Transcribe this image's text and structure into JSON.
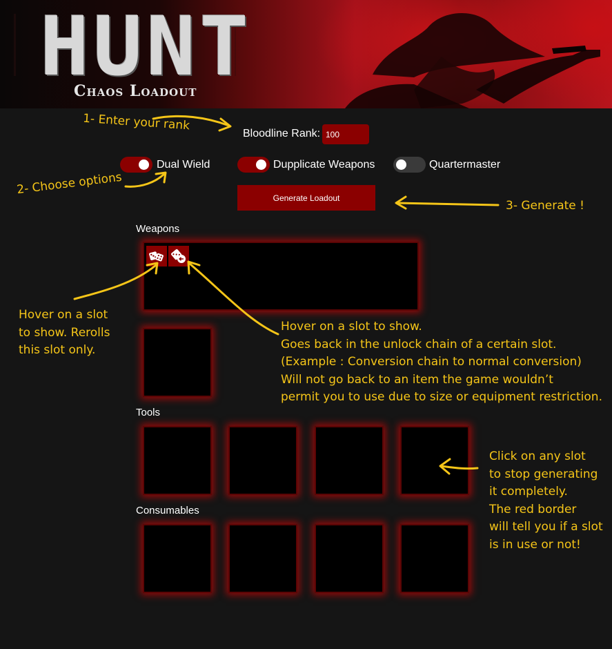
{
  "banner": {
    "title": "HUNT",
    "subtitle": "Chaos Loadout"
  },
  "form": {
    "rank_label": "Bloodline Rank:",
    "rank_value": "100",
    "options": [
      {
        "label": "Dual Wield",
        "on": true
      },
      {
        "label": "Dupplicate Weapons",
        "on": true
      },
      {
        "label": "Quartermaster",
        "on": false
      }
    ],
    "generate_label": "Generate Loadout"
  },
  "sections": {
    "weapons": "Weapons",
    "tools": "Tools",
    "consumables": "Consumables"
  },
  "icons": {
    "reroll": "dice-icon",
    "unlock_back": "dice-back-icon"
  },
  "colors": {
    "accent": "#8b0000",
    "glow": "#ff0000",
    "annotation": "#f5c518",
    "background": "#151515"
  },
  "annotations": {
    "step1": "1- Enter your rank",
    "step2": "2- Choose options",
    "step3": "3- Generate !",
    "reroll_note": [
      "Hover on a slot",
      "to show. Rerolls",
      "this slot only."
    ],
    "unlock_note": [
      "Hover on a slot to show.",
      "Goes back in the unlock chain of a certain slot.",
      "(Example : Conversion chain to normal conversion)",
      "Will not go back to an item the game wouldn’t",
      "permit you to use due to size or equipment restriction."
    ],
    "slot_note": [
      "Click on any slot",
      "to stop generating",
      "it completely.",
      "The red border",
      "will tell you if a slot",
      "is in use or not!"
    ]
  }
}
